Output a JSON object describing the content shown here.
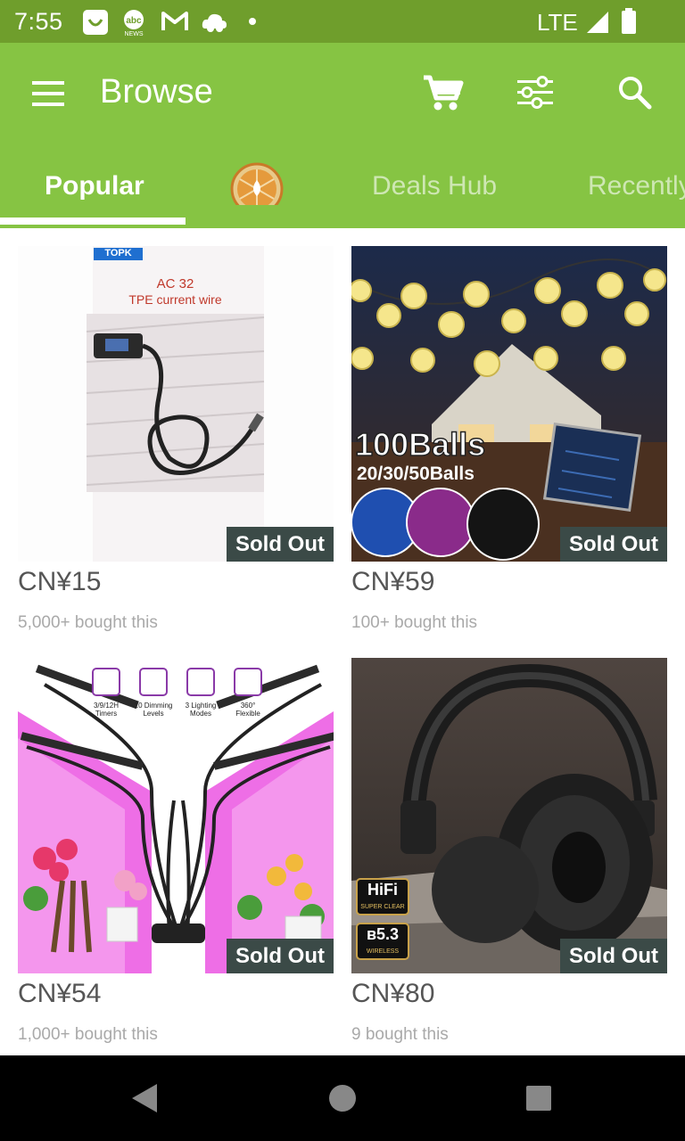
{
  "status_bar": {
    "time": "7:55",
    "network": "LTE",
    "notification_icons": [
      "smile-app-icon",
      "abc-news-icon",
      "gmail-icon",
      "cloud-game-icon",
      "dot-icon"
    ]
  },
  "app_bar": {
    "title": "Browse",
    "actions": [
      "cart-icon",
      "filter-icon",
      "search-icon"
    ],
    "background": "#86c443"
  },
  "tabs": [
    {
      "label": "Popular",
      "active": true
    },
    {
      "label": "",
      "icon": "wheel-icon"
    },
    {
      "label": "Deals Hub"
    },
    {
      "label": "Recently"
    }
  ],
  "products": [
    {
      "price": "CN¥15",
      "bought": "5,000+ bought this",
      "badge": "Sold Out",
      "image_text": {
        "brand": "TOPK",
        "line1": "AC 32",
        "line2": "TPE current wire"
      }
    },
    {
      "price": "CN¥59",
      "bought": "100+ bought this",
      "badge": "Sold Out",
      "image_text": {
        "line1": "100Balls",
        "line2": "20/30/50Balls"
      }
    },
    {
      "price": "CN¥54",
      "bought": "1,000+ bought this",
      "badge": "Sold Out",
      "image_text": {
        "f1": "3/9/12H",
        "f1b": "Timers",
        "f2": "10 Dimming",
        "f2b": "Levels",
        "f3": "3 Lighting",
        "f3b": "Modes",
        "f4": "360°",
        "f4b": "Flexible"
      }
    },
    {
      "price": "CN¥80",
      "bought": "9 bought this",
      "badge": "Sold Out",
      "image_text": {
        "hifi": "HiFi",
        "hifi_sub": "SUPER CLEAR",
        "bt": "ʙ5.3",
        "bt_sub": "WIRELESS"
      }
    }
  ],
  "colors": {
    "status_bar": "#6f9e2c",
    "accent": "#86c443",
    "badge": "#3b4a47"
  }
}
